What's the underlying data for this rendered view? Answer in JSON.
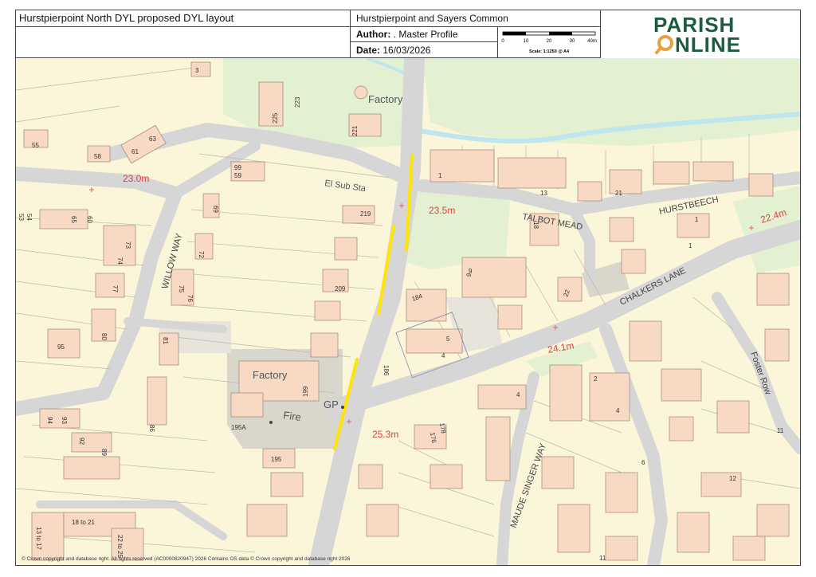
{
  "header": {
    "title": "Hurstpierpoint North DYL proposed DYL layout",
    "parish": "Hurstpierpoint and Sayers Common",
    "author_label": "Author:",
    "author_value": ". Master Profile",
    "date_label": "Date:",
    "date_value": "16/03/2026"
  },
  "scalebar": {
    "ticks": [
      "0",
      "10",
      "20",
      "30",
      "40m"
    ],
    "caption": "Scale: 1:1250 @ A4"
  },
  "logo": {
    "line1": "PARISH",
    "line2_pre": "",
    "line2_post": "NLINE",
    "brand_color": "#1d5c3f",
    "accent_color": "#e8a13b"
  },
  "map": {
    "colors": {
      "land": "#fbf5d9",
      "building": "#f8d9c3",
      "road": "#d8d8d8",
      "green": "#e4f0d2",
      "water": "#bfe6ef",
      "dyl": "#ffe600",
      "grey_area": "#d9d7cc"
    },
    "road_names": [
      "WILLOW WAY",
      "TALBOT MEAD",
      "HURSTBEECH",
      "CHALKERS LANE",
      "Foster Row",
      "MAUDE SINGER WAY"
    ],
    "place_labels": [
      "Factory",
      "El Sub Sta",
      "Factory",
      "GP",
      "Fire"
    ],
    "heights": [
      "23.0m",
      "23.5m",
      "22.4m",
      "24.1m",
      "25.3m"
    ],
    "house_numbers": [
      "3",
      "55",
      "58",
      "61",
      "63",
      "225",
      "223",
      "221",
      "99",
      "59",
      "219",
      "209",
      "69",
      "72",
      "75",
      "76",
      "73",
      "74",
      "77",
      "80",
      "95",
      "81",
      "53",
      "54",
      "65",
      "60",
      "199",
      "195A",
      "195",
      "94",
      "93",
      "92",
      "89",
      "86",
      "184",
      "186",
      "1",
      "13",
      "21",
      "18",
      "22",
      "9",
      "4",
      "5",
      "1",
      "4",
      "6",
      "11",
      "12",
      "18 to 21",
      "22 to 25",
      "13 to 17",
      "176",
      "178",
      "11",
      "1",
      "2",
      "4",
      "9"
    ]
  },
  "footer": {
    "copyright": "© Crown copyright and database right. All rights reserved (AC0000820947) 2026 Contains OS data © Crown copyright and database right 2026"
  }
}
